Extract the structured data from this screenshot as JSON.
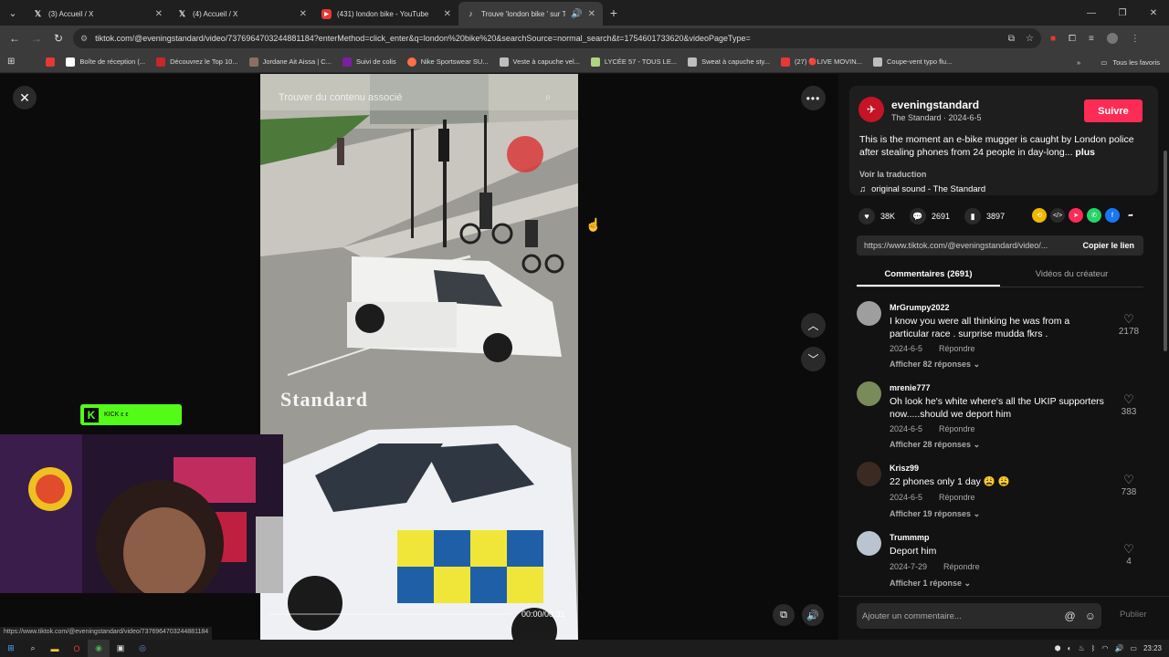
{
  "browser": {
    "tabs": [
      {
        "label": "(3) Accueil / X",
        "icon": "x-logo-icon",
        "active": false
      },
      {
        "label": "(4) Accueil / X",
        "icon": "x-logo-icon",
        "active": false
      },
      {
        "label": "(431) london bike - YouTube",
        "icon": "youtube-icon",
        "active": false
      },
      {
        "label": "Trouve 'london bike ' sur Ti",
        "icon": "tiktok-icon",
        "active": true
      }
    ],
    "url": "tiktok.com/@eveningstandard/video/7376964703244881184?enterMethod=click_enter&q=london%20bike%20&searchSource=normal_search&t=1754601733620&videoPageType=",
    "bookmarks": [
      {
        "label": "",
        "color": "#e53935"
      },
      {
        "label": "Boîte de réception (...",
        "color": "#ffffff"
      },
      {
        "label": "Découvrez le Top 10...",
        "color": "#c62828"
      },
      {
        "label": "Jordane Ait Aissa | C...",
        "color": "#8d6e63"
      },
      {
        "label": "Suivi de colis",
        "color": "#7b1fa2"
      },
      {
        "label": "Nike Sportswear SU...",
        "color": "#ff7043"
      },
      {
        "label": "Veste à capuche vel...",
        "color": "#bdbdbd"
      },
      {
        "label": "LYCÉE 57 - TOUS LE...",
        "color": "#aed581"
      },
      {
        "label": "Sweat à capuche sty...",
        "color": "#bdbdbd"
      },
      {
        "label": "(27) 🔴LIVE MOVIN...",
        "color": "#e53935"
      },
      {
        "label": "Coupe-vent typo flu...",
        "color": "#bdbdbd"
      }
    ],
    "all_bookmarks": "Tous les favoris",
    "status_url": "https://www.tiktok.com/@eveningstandard/video/7376964703244881184"
  },
  "video": {
    "search_overlay": "Trouver du contenu associé",
    "watermark": "Standard",
    "time": "00:00/00:31",
    "progress": 0.0
  },
  "overlay": {
    "kick_label": "KICK ε ε"
  },
  "post": {
    "author": "eveningstandard",
    "subtitle": "The Standard · 2024-6-5",
    "follow": "Suivre",
    "description": "This is the moment an e-bike mugger is caught by London police after stealing phones from 24 people in day-long...",
    "more": "plus",
    "translate": "Voir la traduction",
    "sound": "original sound - The Standard",
    "likes": "38K",
    "comments_count": "2691",
    "saves": "3897",
    "link": "https://www.tiktok.com/@eveningstandard/video/...",
    "copy_link": "Copier le lien",
    "tab_comments": "Commentaires (2691)",
    "tab_creator": "Vidéos du créateur"
  },
  "comments": [
    {
      "user": "MrGrumpy2022",
      "text": "I know you were all thinking he was from a particular race . surprise mudda fkrs .",
      "date": "2024-6-5",
      "reply": "Répondre",
      "replies": "Afficher 82 réponses",
      "likes": "2178",
      "avatar_color": "#9e9e9e"
    },
    {
      "user": "mrenie777",
      "text": "Oh look he's white where's all the UKIP supporters now.....should we deport him",
      "date": "2024-6-5",
      "reply": "Répondre",
      "replies": "Afficher 28 réponses",
      "likes": "383",
      "avatar_color": "#7a8b5a"
    },
    {
      "user": "Krisz99",
      "text": "22 phones only 1 day 😩 😩",
      "date": "2024-6-5",
      "reply": "Répondre",
      "replies": "Afficher 19 réponses",
      "likes": "738",
      "avatar_color": "#3a2a22"
    },
    {
      "user": "Trummmp",
      "text": "Deport him",
      "date": "2024-7-29",
      "reply": "Répondre",
      "replies": "Afficher 1 réponse",
      "likes": "4",
      "avatar_color": "#b9c4d0"
    }
  ],
  "comment_box": {
    "placeholder": "Ajouter un commentaire...",
    "publish": "Publier"
  },
  "taskbar": {
    "clock": "23:23"
  },
  "colors": {
    "accent": "#fe2c55",
    "kick": "#53fc18",
    "background": "#121212"
  }
}
